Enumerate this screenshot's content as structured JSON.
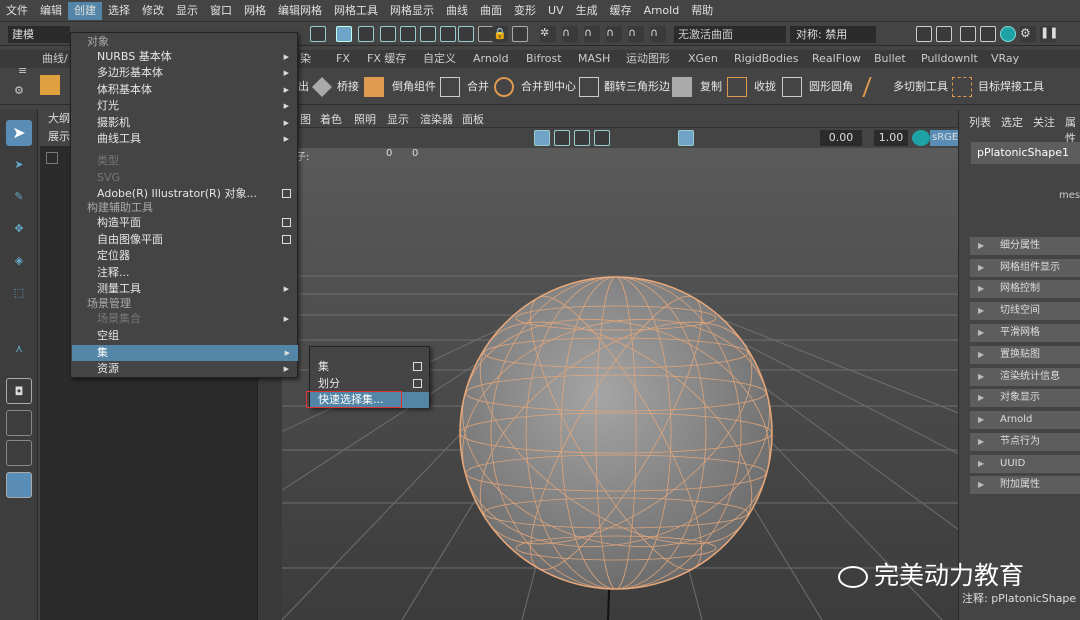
{
  "menubar": [
    "文件",
    "编辑",
    "创建",
    "选择",
    "修改",
    "显示",
    "窗口",
    "网格",
    "编辑网格",
    "网格工具",
    "网格显示",
    "曲线",
    "曲面",
    "变形",
    "UV",
    "生成",
    "缓存",
    "Arnold",
    "帮助"
  ],
  "status": {
    "mode": "建模",
    "live": "无激活曲面",
    "symmetry": "对称: 禁用"
  },
  "shelf_tabs": [
    "曲线/",
    "染",
    "FX",
    "FX 缓存",
    "自定义",
    "Arnold",
    "Bifrost",
    "MASH",
    "运动图形",
    "XGen",
    "RigidBodies",
    "RealFlow",
    "Bullet",
    "PulldownIt",
    "VRay"
  ],
  "shelf_items": [
    "出",
    "桥接",
    "倒角组件",
    "合并",
    "合并到中心",
    "翻转三角形边",
    "复制",
    "收拢",
    "圆形圆角",
    "多切割工具",
    "目标焊接工具"
  ],
  "outliner": {
    "title": "大纲",
    "sub": "展示"
  },
  "viewport_menu": [
    "图",
    "着色",
    "照明",
    "显示",
    "渲染器",
    "面板"
  ],
  "viewport_vals": {
    "v1": "0.00",
    "v2": "1.00",
    "cs": "sRGE"
  },
  "hud": {
    "label": "面子:",
    "a": "0",
    "b": "0"
  },
  "right_tabs": [
    "列表",
    "选定",
    "关注",
    "属性"
  ],
  "node_tab": "pPlatonicShape1",
  "mesh_label": "mesh",
  "attributes": [
    "细分属性",
    "网格组件显示",
    "网格控制",
    "切线空间",
    "平滑网格",
    "置换贴图",
    "渲染统计信息",
    "对象显示",
    "Arnold",
    "节点行为",
    "UUID",
    "附加属性"
  ],
  "note": "注释: pPlatonicShape",
  "create_menu": {
    "sections": [
      "对象",
      "构建辅助工具",
      "场景管理"
    ],
    "items": [
      "NURBS 基本体",
      "多边形基本体",
      "体积基本体",
      "灯光",
      "摄影机",
      "曲线工具",
      "类型",
      "SVG",
      "Adobe(R) Illustrator(R) 对象...",
      "构造平面",
      "自由图像平面",
      "定位器",
      "注释...",
      "测量工具",
      "场景集合",
      "空组",
      "集",
      "资源"
    ]
  },
  "sub_menu": [
    "集",
    "划分",
    "快速选择集..."
  ],
  "watermark": "完美动力教育",
  "colors": {
    "highlight": "#5285a6",
    "wire": "#e8a87a"
  }
}
